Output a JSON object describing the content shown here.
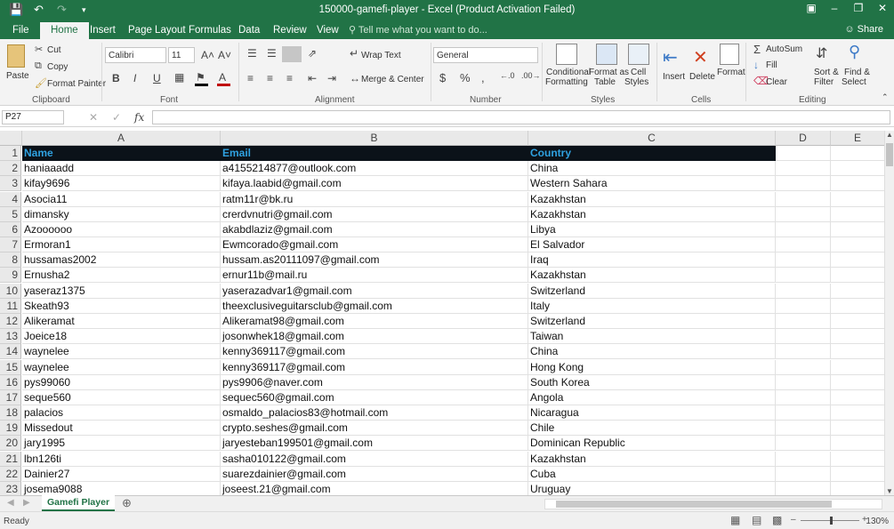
{
  "colors": {
    "excel_green": "#217346",
    "header_fill": "#0b1219",
    "header_text": "#2fa1e0"
  },
  "window": {
    "title": "150000-gamefi-player - Excel (Product Activation Failed)"
  },
  "menu": {
    "items": [
      "File",
      "Home",
      "Insert",
      "Page Layout",
      "Formulas",
      "Data",
      "Review",
      "View"
    ],
    "active": "Home",
    "tell_me": "Tell me what you want to do...",
    "share": "Share"
  },
  "ribbon": {
    "clipboard": {
      "label": "Clipboard",
      "paste": "Paste",
      "cut": "Cut",
      "copy": "Copy",
      "format_painter": "Format Painter"
    },
    "font": {
      "label": "Font",
      "family": "Calibri",
      "size": "11"
    },
    "alignment": {
      "label": "Alignment",
      "wrap_text": "Wrap Text",
      "merge_center": "Merge & Center"
    },
    "number": {
      "label": "Number",
      "format": "General"
    },
    "styles": {
      "label": "Styles",
      "conditional": "Conditional",
      "formatting": "Formatting",
      "format_as": "Format as",
      "table": "Table",
      "cell": "Cell",
      "cell_styles": "Styles"
    },
    "cells": {
      "label": "Cells",
      "insert": "Insert",
      "delete": "Delete",
      "format": "Format"
    },
    "editing": {
      "label": "Editing",
      "autosum": "AutoSum",
      "fill": "Fill",
      "clear": "Clear",
      "sort": "Sort &",
      "filter": "Filter",
      "find": "Find &",
      "select": "Select"
    }
  },
  "formula_bar": {
    "name_box": "P27",
    "fx": "fx",
    "content": ""
  },
  "columns": [
    "A",
    "B",
    "C",
    "D",
    "E"
  ],
  "headers": [
    "Name",
    "Email",
    "Country"
  ],
  "rows": [
    [
      "haniaaadd",
      "a4155214877@outlook.com",
      "China"
    ],
    [
      "kifay9696",
      "kifaya.laabid@gmail.com",
      "Western Sahara"
    ],
    [
      "Asocia11",
      "ratm11r@bk.ru",
      "Kazakhstan"
    ],
    [
      "dimansky",
      "crerdvnutri@gmail.com",
      "Kazakhstan"
    ],
    [
      "Azoooooo",
      "akabdlaziz@gmail.com",
      "Libya"
    ],
    [
      "Ermoran1",
      "Ewmcorado@gmail.com",
      "El Salvador"
    ],
    [
      "hussamas2002",
      "hussam.as20111097@gmail.com",
      "Iraq"
    ],
    [
      "Ernusha2",
      "ernur11b@mail.ru",
      "Kazakhstan"
    ],
    [
      "yaseraz1375",
      "yaserazadvar1@gmail.com",
      "Switzerland"
    ],
    [
      "Skeath93",
      "theexclusiveguitarsclub@gmail.com",
      "Italy"
    ],
    [
      "Alikeramat",
      "Alikeramat98@gmail.com",
      "Switzerland"
    ],
    [
      "Joeice18",
      "josonwhek18@gmail.com",
      "Taiwan"
    ],
    [
      "waynelee",
      "kenny369117@gmail.com",
      "China"
    ],
    [
      "waynelee",
      "kenny369117@gmail.com",
      "Hong Kong"
    ],
    [
      "pys99060",
      "pys9906@naver.com",
      "South Korea"
    ],
    [
      "seque560",
      "sequec560@gmail.com",
      "Angola"
    ],
    [
      "palacios",
      "osmaldo_palacios83@hotmail.com",
      "Nicaragua"
    ],
    [
      "Missedout",
      "crypto.seshes@gmail.com",
      "Chile"
    ],
    [
      "jary1995",
      "jaryesteban199501@gmail.com",
      "Dominican Republic"
    ],
    [
      "lbn126ti",
      "sasha010122@gmail.com",
      "Kazakhstan"
    ],
    [
      "Dainier27",
      "suarezdainier@gmail.com",
      "Cuba"
    ],
    [
      "josema9088",
      "joseest.21@gmail.com",
      "Uruguay"
    ]
  ],
  "row_numbers": [
    "1",
    "2",
    "3",
    "4",
    "5",
    "6",
    "7",
    "8",
    "9",
    "10",
    "11",
    "12",
    "13",
    "14",
    "15",
    "16",
    "17",
    "18",
    "19",
    "20",
    "21",
    "22",
    "23"
  ],
  "sheet_tab": "Gamefi Player",
  "status": {
    "text": "Ready",
    "zoom": "130%"
  }
}
